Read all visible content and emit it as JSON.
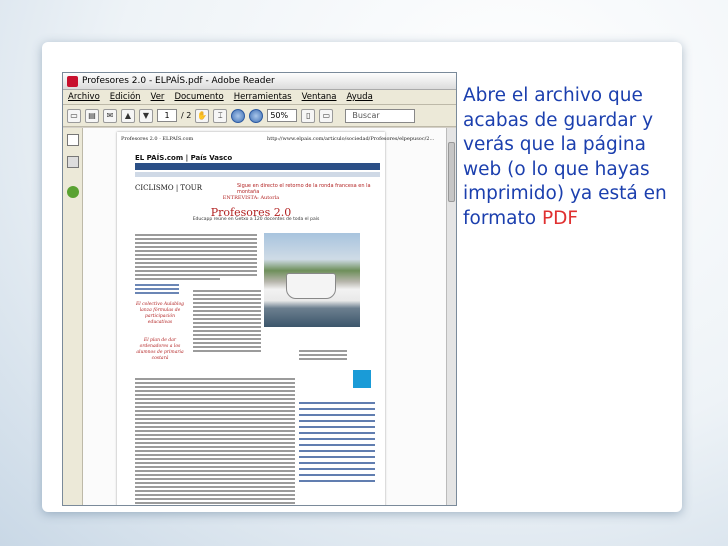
{
  "window": {
    "title": "Profesores 2.0 - ELPAÍS.pdf - Adobe Reader"
  },
  "menu": [
    "Archivo",
    "Edición",
    "Ver",
    "Documento",
    "Herramientas",
    "Ventana",
    "Ayuda"
  ],
  "toolbar": {
    "page_current": "1",
    "page_total": "/ 2",
    "zoom": "50%",
    "search_placeholder": "Buscar"
  },
  "pdf_page": {
    "header_left": "Profesores 2.0 · ELPAÍS.com",
    "header_url": "http://www.elpais.com/articulo/sociedad/Profesores/elpepusoc/2...",
    "masthead": "EL PAÍS.com | País Vasco",
    "section": "CICLISMO | TOUR",
    "kicker_red": "Sigue en directo el retorno de la ronda francesa en la montaña",
    "title_kicker": "ENTREVISTA: Autorla",
    "title": "Profesores 2.0",
    "subtitle": "Educapp reúne en Getxo a 120 docentes de toda el país",
    "quote_1": "El colectivo Aulablog lanza fórmulas de participación educativas",
    "quote_2": "El plan de dar ordenadores a los alumnos de primaria costará"
  },
  "slide_caption": {
    "text": "Abre el archivo que acabas de guardar y verás que la página web (o lo que hayas imprimido) ya está en formato",
    "highlight": "PDF"
  },
  "colors": {
    "caption": "#1b3fae",
    "highlight": "#e03030",
    "accent_red": "#b22222"
  }
}
